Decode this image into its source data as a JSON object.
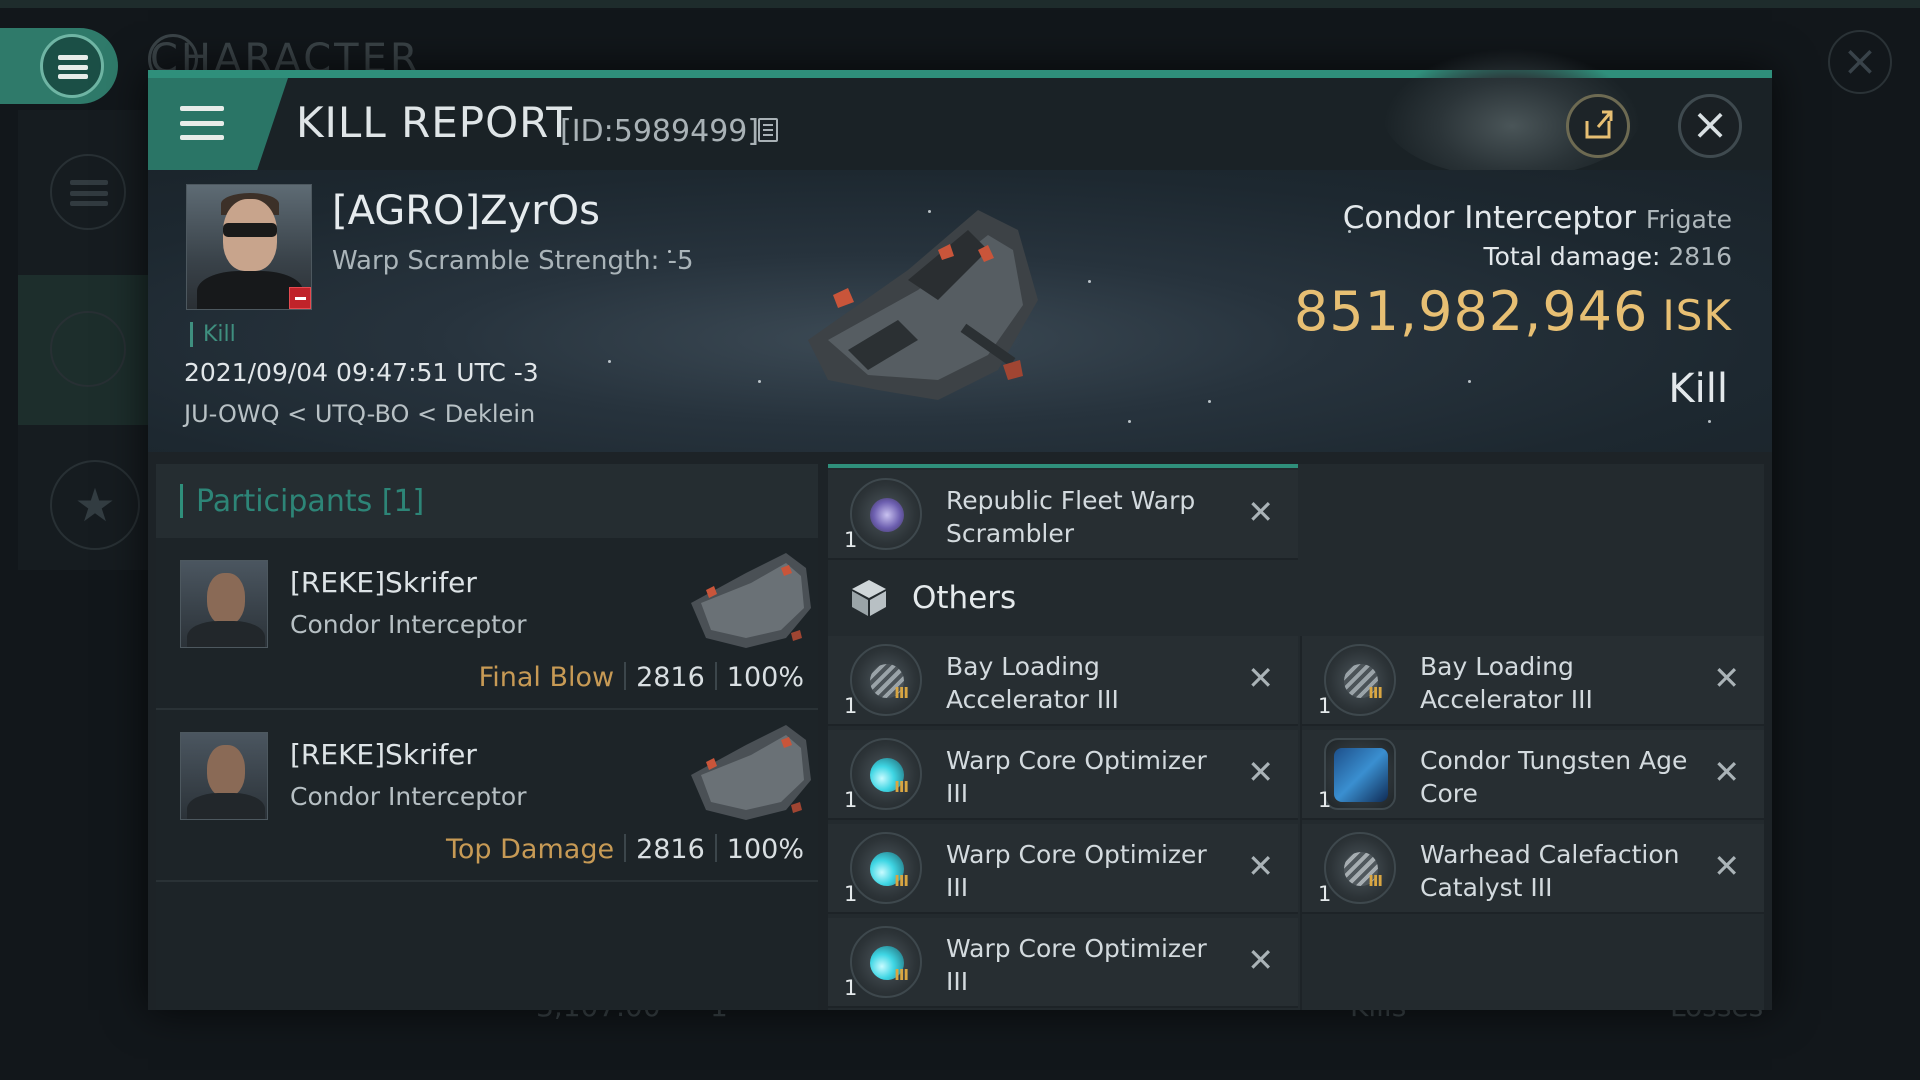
{
  "background": {
    "title": "CHARACTER",
    "bottom_value": "3,107.00",
    "bottom_count": "1",
    "bottom_kills": "Kills",
    "bottom_losses": "Losses"
  },
  "modal": {
    "title": "KILL REPORT",
    "report_id": "[ID:5989499]"
  },
  "victim": {
    "name": "[AGRO]ZyrOs",
    "detail": "Warp Scramble Strength: -5",
    "tag": "Kill",
    "datetime": "2021/09/04 09:47:51 UTC -3",
    "location": "JU-OWQ < UTQ-BO < Deklein",
    "ship_name": "Condor Interceptor",
    "ship_class": "Frigate",
    "total_damage_label": "Total damage:",
    "total_damage": "2816",
    "isk_value": "851,982,946",
    "isk_unit": "ISK",
    "result": "Kill"
  },
  "participants": {
    "title": "Participants [1]",
    "rows": [
      {
        "name": "[REKE]Skrifer",
        "ship": "Condor Interceptor",
        "label": "Final Blow",
        "damage": "2816",
        "percent": "100%"
      },
      {
        "name": "[REKE]Skrifer",
        "ship": "Condor Interceptor",
        "label": "Top Damage",
        "damage": "2816",
        "percent": "100%"
      }
    ]
  },
  "items": {
    "top": {
      "name": "Republic Fleet Warp Scrambler",
      "qty": "1"
    },
    "others_label": "Others",
    "left": [
      {
        "name": "Bay Loading Accelerator III",
        "qty": "1"
      },
      {
        "name": "Warp Core Optimizer III",
        "qty": "1"
      },
      {
        "name": "Warp Core Optimizer III",
        "qty": "1"
      },
      {
        "name": "Warp Core Optimizer III",
        "qty": "1"
      }
    ],
    "right": [
      {
        "name": "Bay Loading Accelerator III",
        "qty": "1"
      },
      {
        "name": "Condor Tungsten Age Core",
        "qty": "1"
      },
      {
        "name": "Warhead Calefaction Catalyst III",
        "qty": "1"
      }
    ],
    "icons": {
      "scrambler": "warp-scrambler-icon",
      "bay_loading": "bay-loading-accelerator-icon",
      "warp_core": "warp-core-optimizer-icon",
      "tungsten": "tungsten-core-icon",
      "warhead": "warhead-catalyst-icon"
    }
  },
  "colors": {
    "accent": "#2f8f7b",
    "isk": "#e7bf73",
    "label_gold": "#c79a55",
    "badge_red": "#c0232a"
  }
}
